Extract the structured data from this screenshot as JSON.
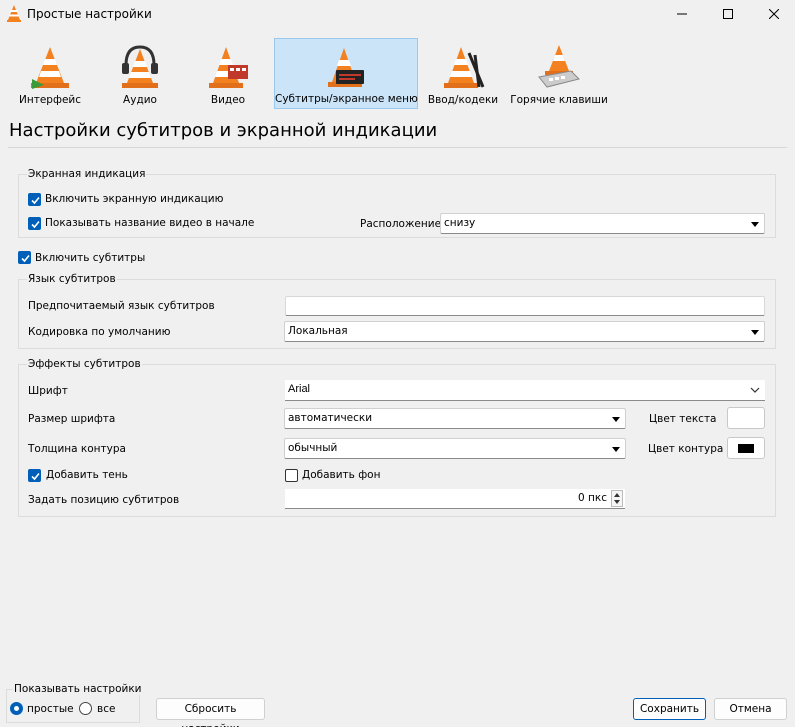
{
  "window": {
    "title": "Простые настройки",
    "icon": "vlc-cone-icon"
  },
  "tabs": [
    {
      "label": "Интерфейс",
      "icon": "interface-cone-icon",
      "selected": false
    },
    {
      "label": "Аудио",
      "icon": "audio-headphones-cone-icon",
      "selected": false
    },
    {
      "label": "Видео",
      "icon": "video-film-cone-icon",
      "selected": false
    },
    {
      "label": "Субтитры/экранное меню",
      "icon": "subtitles-cone-icon",
      "selected": true
    },
    {
      "label": "Ввод/кодеки",
      "icon": "codecs-cone-icon",
      "selected": false
    },
    {
      "label": "Горячие клавиши",
      "icon": "hotkeys-cone-icon",
      "selected": false
    }
  ],
  "page_title": "Настройки субтитров и экранной индикации",
  "osd": {
    "group_title": "Экранная индикация",
    "enable_osd": {
      "label": "Включить экранную индикацию",
      "checked": true
    },
    "show_title": {
      "label": "Показывать название видео в начале",
      "checked": true
    },
    "position_label": "Расположение",
    "position_value": "снизу"
  },
  "enable_subtitles": {
    "label": "Включить субтитры",
    "checked": true
  },
  "language": {
    "group_title": "Язык субтитров",
    "preferred_label": "Предпочитаемый язык субтитров",
    "preferred_value": "",
    "encoding_label": "Кодировка по умолчанию",
    "encoding_value": "Локальная"
  },
  "effects": {
    "group_title": "Эффекты субтитров",
    "font_label": "Шрифт",
    "font_value": "Arial",
    "font_size_label": "Размер шрифта",
    "font_size_value": "автоматически",
    "text_color_label": "Цвет текста",
    "text_color": "#ffffff",
    "outline_label": "Толщина контура",
    "outline_value": "обычный",
    "outline_color_label": "Цвет контура",
    "outline_color": "#000000",
    "shadow": {
      "label": "Добавить тень",
      "checked": true
    },
    "background": {
      "label": "Добавить фон",
      "checked": false
    },
    "position_label": "Задать позицию субтитров",
    "position_value": "0 пкс"
  },
  "footer": {
    "show_group_title": "Показывать настройки",
    "simple_label": "простые",
    "all_label": "все",
    "simple_selected": true,
    "reset_label": "Сбросить настройки",
    "save_label": "Сохранить",
    "cancel_label": "Отмена"
  },
  "colors": {
    "accent": "#005fb8",
    "selected_tab_bg": "#cce4f7",
    "cone_orange": "#f48120"
  }
}
